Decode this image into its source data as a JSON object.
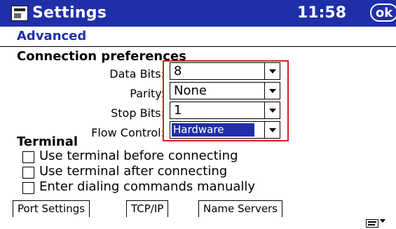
{
  "titlebar": {
    "title": "Settings",
    "clock": "11:58",
    "ok_label": "ok",
    "app_icon": "app-icon"
  },
  "subheader": {
    "title": "Advanced"
  },
  "connection": {
    "title": "Connection preferences",
    "fields": [
      {
        "label": "Data Bits:",
        "value": "8"
      },
      {
        "label": "Parity:",
        "value": "None"
      },
      {
        "label": "Stop Bits:",
        "value": "1"
      },
      {
        "label": "Flow Control:",
        "value": "Hardware"
      }
    ]
  },
  "terminal": {
    "title": "Terminal",
    "options": [
      {
        "label": "Use terminal before connecting"
      },
      {
        "label": "Use terminal after connecting"
      },
      {
        "label": "Enter dialing commands manually"
      }
    ]
  },
  "tabs": [
    {
      "label": "Port Settings"
    },
    {
      "label": "TCP/IP"
    },
    {
      "label": "Name Servers"
    }
  ],
  "icons": {
    "keyboard": "keyboard-icon",
    "sip_arrow": "sip-arrow-icon",
    "dropdown": "dropdown-arrow-icon"
  },
  "colors": {
    "titlebar": "#1f2fa8",
    "accent": "#1f2fa8",
    "highlight_border": "#d62020"
  }
}
